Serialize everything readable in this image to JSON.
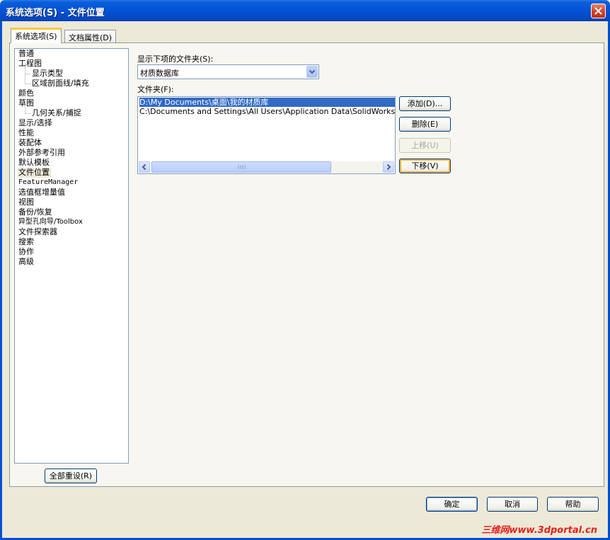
{
  "window": {
    "title": "系统选项(S) - 文件位置"
  },
  "tabs": [
    {
      "label": "系统选项(S)",
      "active": true
    },
    {
      "label": "文档属性(D)",
      "active": false
    }
  ],
  "tree": {
    "items": [
      {
        "label": "普通",
        "indent": 0
      },
      {
        "label": "工程图",
        "indent": 0
      },
      {
        "label": "显示类型",
        "indent": 1
      },
      {
        "label": "区域剖面线/填充",
        "indent": 1
      },
      {
        "label": "颜色",
        "indent": 0
      },
      {
        "label": "草图",
        "indent": 0
      },
      {
        "label": "几何关系/捕捉",
        "indent": 1
      },
      {
        "label": "显示/选择",
        "indent": 0
      },
      {
        "label": "性能",
        "indent": 0
      },
      {
        "label": "装配体",
        "indent": 0
      },
      {
        "label": "外部参考引用",
        "indent": 0
      },
      {
        "label": "默认模板",
        "indent": 0
      },
      {
        "label": "文件位置",
        "indent": 0,
        "selected": true
      },
      {
        "label": "FeatureManager",
        "indent": 0
      },
      {
        "label": "选值框增量值",
        "indent": 0
      },
      {
        "label": "视图",
        "indent": 0
      },
      {
        "label": "备份/恢复",
        "indent": 0
      },
      {
        "label": "异型孔向导/Toolbox",
        "indent": 0
      },
      {
        "label": "文件探索器",
        "indent": 0
      },
      {
        "label": "搜索",
        "indent": 0
      },
      {
        "label": "协作",
        "indent": 0
      },
      {
        "label": "高级",
        "indent": 0
      }
    ],
    "reset_button": "全部重设(R)"
  },
  "main": {
    "show_folders_label": "显示下项的文件夹(S):",
    "show_folders_value": "材质数据库",
    "folders_label": "文件夹(F):",
    "folders": [
      {
        "path": "D:\\My Documents\\桌面\\我的材质库",
        "selected": true
      },
      {
        "path": "C:\\Documents and Settings\\All Users\\Application Data\\SolidWorks\\SolidWor",
        "selected": false
      }
    ],
    "buttons": {
      "add": "添加(D)...",
      "delete": "删除(E)",
      "move_up": "上移(U)",
      "move_down": "下移(V)"
    }
  },
  "footer": {
    "ok": "确定",
    "cancel": "取消",
    "help": "帮助"
  },
  "watermark": "三维网www.3dportal.cn"
}
